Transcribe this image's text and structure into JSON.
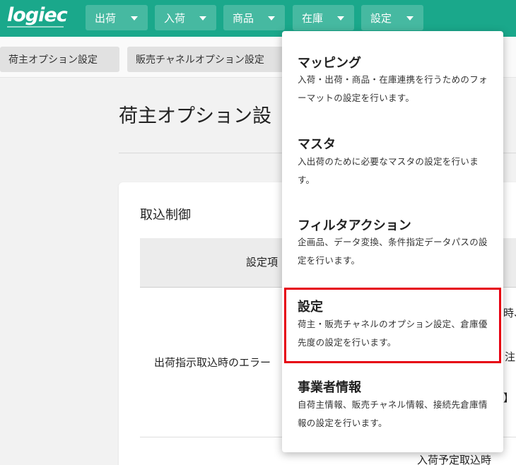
{
  "brand": {
    "logo_text": "logiec"
  },
  "topnav": {
    "items": [
      {
        "label": "出荷"
      },
      {
        "label": "入荷"
      },
      {
        "label": "商品"
      },
      {
        "label": "在庫"
      },
      {
        "label": "設定"
      }
    ]
  },
  "subnav": {
    "tabs": [
      {
        "label": "荷主オプション設定"
      },
      {
        "label": "販売チャネルオプション設定"
      }
    ]
  },
  "main": {
    "page_title": "荷主オプション設",
    "section_title": "取込制御",
    "table": {
      "header_label": "設定項",
      "row1_label": "出荷指示取込時のエラー",
      "partial_cells": [
        "時、",
        "注",
        "】",
        "入荷予定取込時"
      ]
    }
  },
  "dropdown": {
    "items": [
      {
        "title": "マッピング",
        "description": "入荷・出荷・商品・在庫連携を行うためのフォーマットの設定を行います。"
      },
      {
        "title": "マスタ",
        "description": "入出荷のために必要なマスタの設定を行います。"
      },
      {
        "title": "フィルタアクション",
        "description": "企画品、データ変換、条件指定データパスの設定を行います。"
      },
      {
        "title": "設定",
        "description": "荷主・販売チャネルのオプション設定、倉庫優先度の設定を行います。"
      },
      {
        "title": "事業者情報",
        "description": "自荷主情報、販売チャネル情報、接続先倉庫情報の設定を行います。"
      }
    ]
  },
  "colors": {
    "topbar": "#1aa88b",
    "nav_button": "#46b9a1",
    "highlight": "#e60012"
  }
}
